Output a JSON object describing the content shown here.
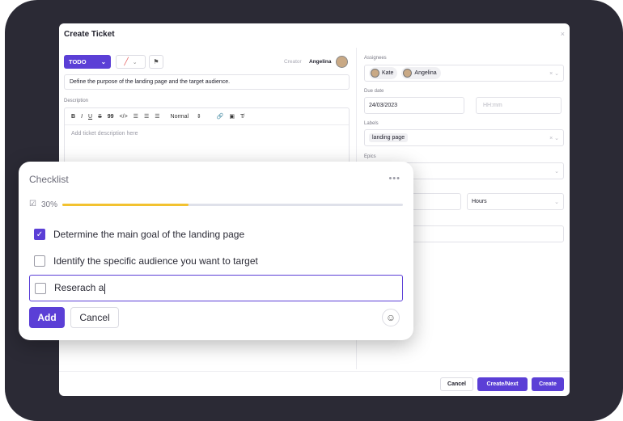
{
  "modal": {
    "title": "Create Ticket",
    "close": "×",
    "status": {
      "label": "TODO",
      "chevron": "⌄"
    },
    "color_picker": {
      "value": "╱",
      "chevron": "⌄"
    },
    "flag": "⚑",
    "creator_label": "Creator",
    "creator_name": "Angelina",
    "ticket_title": "Define the purpose of the landing page and the target audience.",
    "description_label": "Description",
    "toolbar": [
      "B",
      "I",
      "U",
      "S",
      "99",
      "</>",
      "☰",
      "☰",
      "☰"
    ],
    "toolbar_format": "Normal",
    "toolbar_format_arrow": "⇕",
    "toolbar_extra": [
      "🔗",
      "▣",
      "T̸"
    ],
    "description_placeholder": "Add ticket description here",
    "assignees_label": "Assignees",
    "assignees": [
      "Kate",
      "Angelina"
    ],
    "due_date_label": "Due date",
    "due_date": "24/03/2023",
    "time_placeholder": "HH:mm",
    "labels_label": "Labels",
    "label_value": "landing page",
    "epics_label": "Epics",
    "estimate_unit": "Hours",
    "clear": "×",
    "chevron": "⌄",
    "footer": {
      "cancel": "Cancel",
      "create_next": "Create/Next",
      "create": "Create"
    }
  },
  "checklist": {
    "title": "Checklist",
    "menu": "•••",
    "progress_icon": "☑",
    "progress_text": "30%",
    "progress_fraction": 0.37,
    "items": [
      {
        "text": "Determine the main goal of the landing page",
        "checked": true
      },
      {
        "text": "Identify the specific audience you want to target",
        "checked": false
      }
    ],
    "editing_text": "Reserach a",
    "check_mark": "✓",
    "add_label": "Add",
    "cancel_label": "Cancel",
    "emoji": "☺"
  },
  "colors": {
    "accent": "#5b3fd6",
    "progress": "#f2c230",
    "frame": "#2b2a35"
  }
}
